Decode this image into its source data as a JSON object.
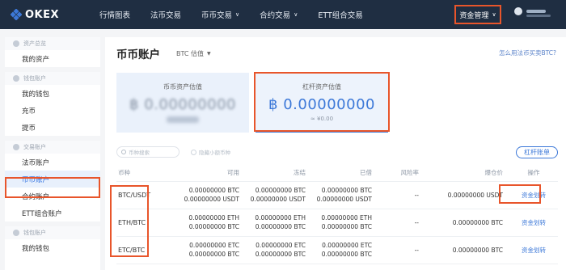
{
  "brand": {
    "logo_text": "OKEX"
  },
  "nav": {
    "items": [
      {
        "label": "行情图表",
        "has_dropdown": false
      },
      {
        "label": "法币交易",
        "has_dropdown": false
      },
      {
        "label": "币币交易",
        "has_dropdown": true
      },
      {
        "label": "合约交易",
        "has_dropdown": true
      },
      {
        "label": "ETT组合交易",
        "has_dropdown": false
      }
    ],
    "asset_mgmt_label": "资金管理"
  },
  "sidebar": {
    "groups": [
      {
        "title": "资产总览",
        "items": [
          {
            "label": "我的资产",
            "active": false
          }
        ]
      },
      {
        "title": "钱包账户",
        "items": [
          {
            "label": "我的钱包",
            "active": false
          },
          {
            "label": "充币",
            "active": false
          },
          {
            "label": "提币",
            "active": false
          }
        ]
      },
      {
        "title": "交易账户",
        "items": [
          {
            "label": "法币账户",
            "active": false
          },
          {
            "label": "币币账户",
            "active": true
          },
          {
            "label": "合约账户",
            "active": false
          },
          {
            "label": "ETT组合账户",
            "active": false
          }
        ]
      },
      {
        "title": "钱包账户",
        "items": [
          {
            "label": "我的钱包",
            "active": false
          }
        ]
      }
    ]
  },
  "main": {
    "title": "币币账户",
    "valuation_label": "BTC 估值",
    "help_link": "怎么用法币买卖BTC?",
    "cards": {
      "spot": {
        "label": "币币资产估值",
        "value": "฿ 0.00000000"
      },
      "margin": {
        "label": "杠杆资产估值",
        "value": "฿ 0.00000000",
        "sub": "≈ ¥0.00"
      }
    },
    "search_placeholder": "币种搜索",
    "hide_small_label": "隐藏小额币种",
    "ledger_button": "杠杆账单",
    "table": {
      "headers": [
        "币种",
        "可用",
        "冻结",
        "已借",
        "风险率",
        "爆仓价",
        "操作"
      ],
      "rows": [
        {
          "pair": "BTC/USDT",
          "available": [
            "0.00000000 BTC",
            "0.00000000 USDT"
          ],
          "frozen": [
            "0.00000000 BTC",
            "0.00000000 USDT"
          ],
          "borrowed": [
            "0.00000000 BTC",
            "0.00000000 USDT"
          ],
          "risk": "--",
          "liq_price": "0.00000000 USDT",
          "action": "资金划转"
        },
        {
          "pair": "ETH/BTC",
          "available": [
            "0.00000000 ETH",
            "0.00000000 BTC"
          ],
          "frozen": [
            "0.00000000 ETH",
            "0.00000000 BTC"
          ],
          "borrowed": [
            "0.00000000 ETH",
            "0.00000000 BTC"
          ],
          "risk": "--",
          "liq_price": "0.00000000 BTC",
          "action": "资金划转"
        },
        {
          "pair": "ETC/BTC",
          "available": [
            "0.00000000 ETC",
            "0.00000000 BTC"
          ],
          "frozen": [
            "0.00000000 ETC",
            "0.00000000 BTC"
          ],
          "borrowed": [
            "0.00000000 ETC",
            "0.00000000 BTC"
          ],
          "risk": "--",
          "liq_price": "0.00000000 BTC",
          "action": "资金划转"
        }
      ]
    }
  },
  "colors": {
    "nav_bg": "#1f2e42",
    "accent": "#3c78d8",
    "highlight": "#e8552b"
  }
}
